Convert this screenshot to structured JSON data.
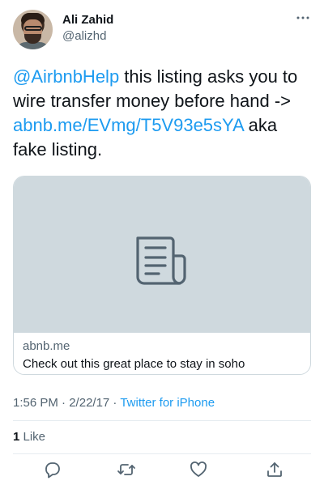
{
  "tweet": {
    "author": {
      "display_name": "Ali Zahid",
      "handle": "@alizhd"
    },
    "text": {
      "mention": "@AirbnbHelp",
      "part1": " this listing asks you to wire transfer money before hand -> ",
      "url": "abnb.me/EVmg/T5V93e5sYA",
      "part2": " aka fake listing."
    },
    "card": {
      "domain": "abnb.me",
      "title": "Check out this great place to stay in soho",
      "icon": "document-icon"
    },
    "meta": {
      "time": "1:56 PM",
      "separator1": " · ",
      "date": "2/22/17",
      "separator2": " · ",
      "source": "Twitter for iPhone"
    },
    "likes": {
      "count": "1",
      "label": " Like"
    },
    "actions": {
      "reply_icon": "reply-icon",
      "retweet_icon": "retweet-icon",
      "like_icon": "like-icon",
      "share_icon": "share-icon"
    },
    "colors": {
      "link": "#1d9bf0",
      "secondary_text": "#536471",
      "card_media_bg": "#cfd9de"
    }
  }
}
